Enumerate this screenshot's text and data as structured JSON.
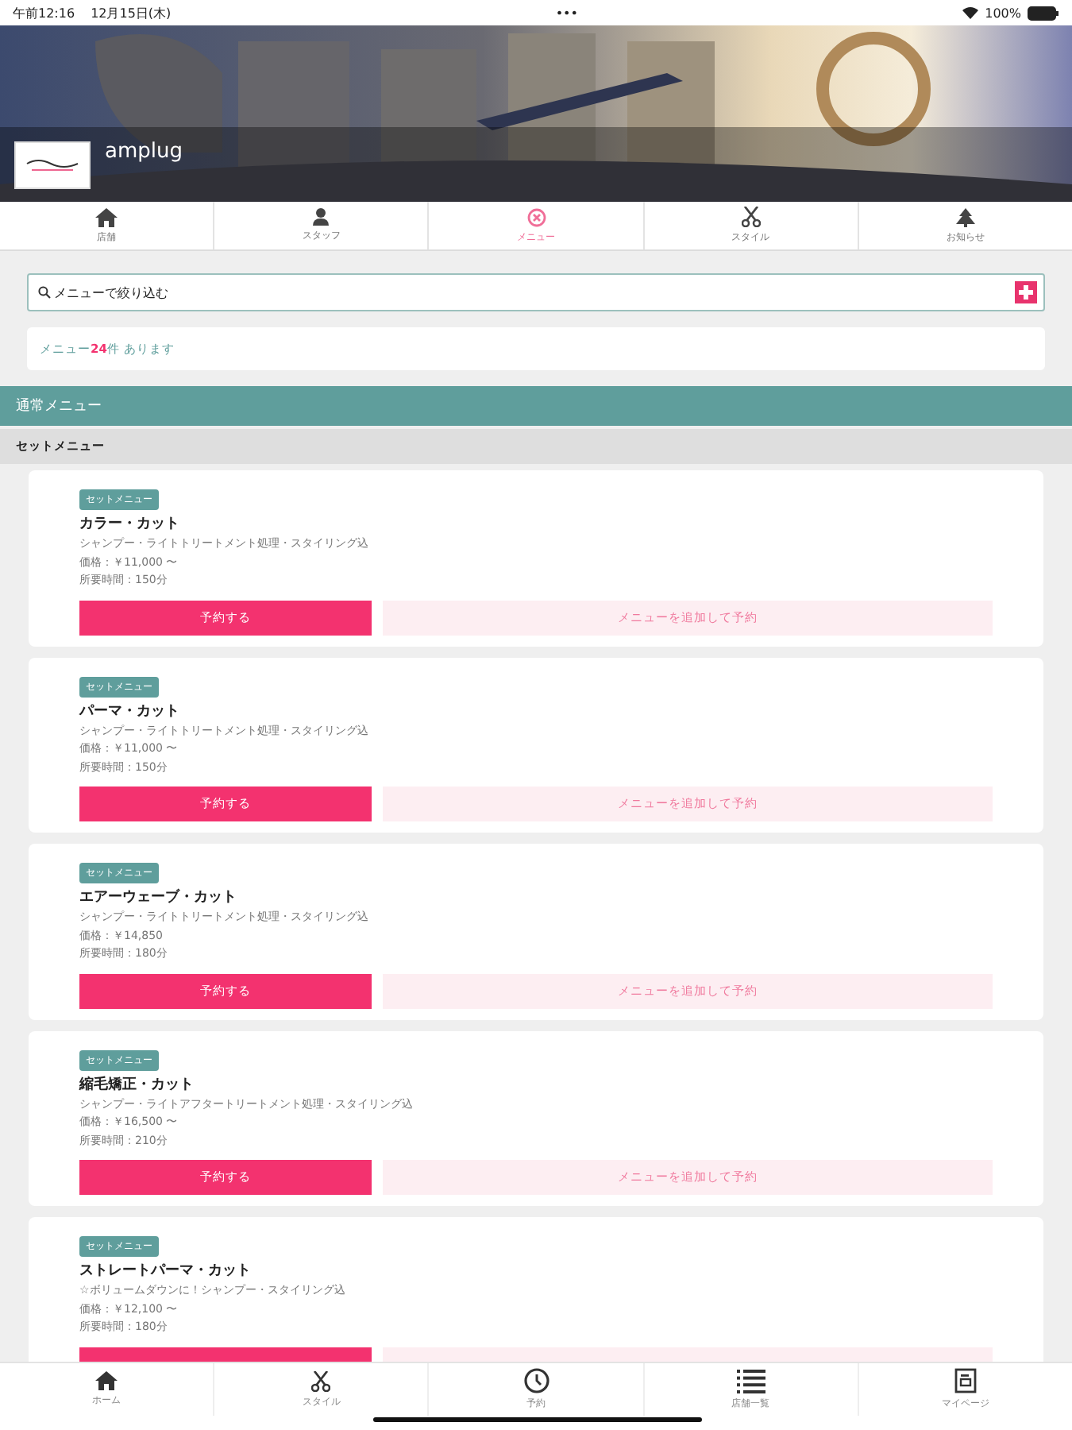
{
  "status_bar": {
    "time": "午前12:16",
    "date": "12月15日(木)",
    "dots": "•••",
    "battery": "100%"
  },
  "header": {
    "shop_name": "amplug"
  },
  "top_tabs": [
    {
      "label": "店舗",
      "selected": false
    },
    {
      "label": "スタッフ",
      "selected": false
    },
    {
      "label": "メニュー",
      "selected": true
    },
    {
      "label": "スタイル",
      "selected": false
    },
    {
      "label": "お知らせ",
      "selected": false
    }
  ],
  "search": {
    "placeholder": "メニューで絞り込む"
  },
  "info": "メニュー**24**件 あります",
  "section": {
    "title": "通常メニュー",
    "subsection": "セットメニュー"
  },
  "cards": [
    {
      "kind": "full",
      "tag": "セットメニュー",
      "name": "カラー・カット",
      "description": "シャンプー・ライトトリートメント処理・スタイリング込",
      "price": "価格：￥11,000 〜",
      "duration": "所要時間：150分",
      "book": "予約する",
      "add": "メニューを追加して予約"
    },
    {
      "kind": "full",
      "tag": "セットメニュー",
      "name": "パーマ・カット",
      "description": "シャンプー・ライトトリートメント処理・スタイリング込",
      "price": "価格：￥11,000 〜",
      "duration": "所要時間：150分",
      "book": "予約する",
      "add": "メニューを追加して予約"
    },
    {
      "kind": "full",
      "tag": "セットメニュー",
      "name": "エアーウェーブ・カット",
      "description": "シャンプー・ライトトリートメント処理・スタイリング込",
      "price": "価格：￥14,850",
      "duration": "所要時間：180分",
      "book": "予約する",
      "add": "メニューを追加して予約"
    },
    {
      "kind": "full",
      "tag": "セットメニュー",
      "name": "縮毛矯正・カット",
      "description": "シャンプー・ライトアフタートリートメント処理・スタイリング込",
      "price": "価格：￥16,500 〜",
      "duration": "所要時間：210分",
      "book": "予約する",
      "add": "メニューを追加して予約"
    },
    {
      "kind": "cut",
      "tag": "セットメニュー",
      "name": "ストレートパーマ・カット",
      "description": "☆ボリュームダウンに！シャンプー・スタイリング込",
      "price": "価格：￥12,100 〜",
      "duration": "所要時間：180分"
    }
  ],
  "bottom_nav": [
    {
      "label": "ホーム"
    },
    {
      "label": "スタイル"
    },
    {
      "label": "予約"
    },
    {
      "label": "店舗一覧"
    },
    {
      "label": "マイページ"
    }
  ]
}
